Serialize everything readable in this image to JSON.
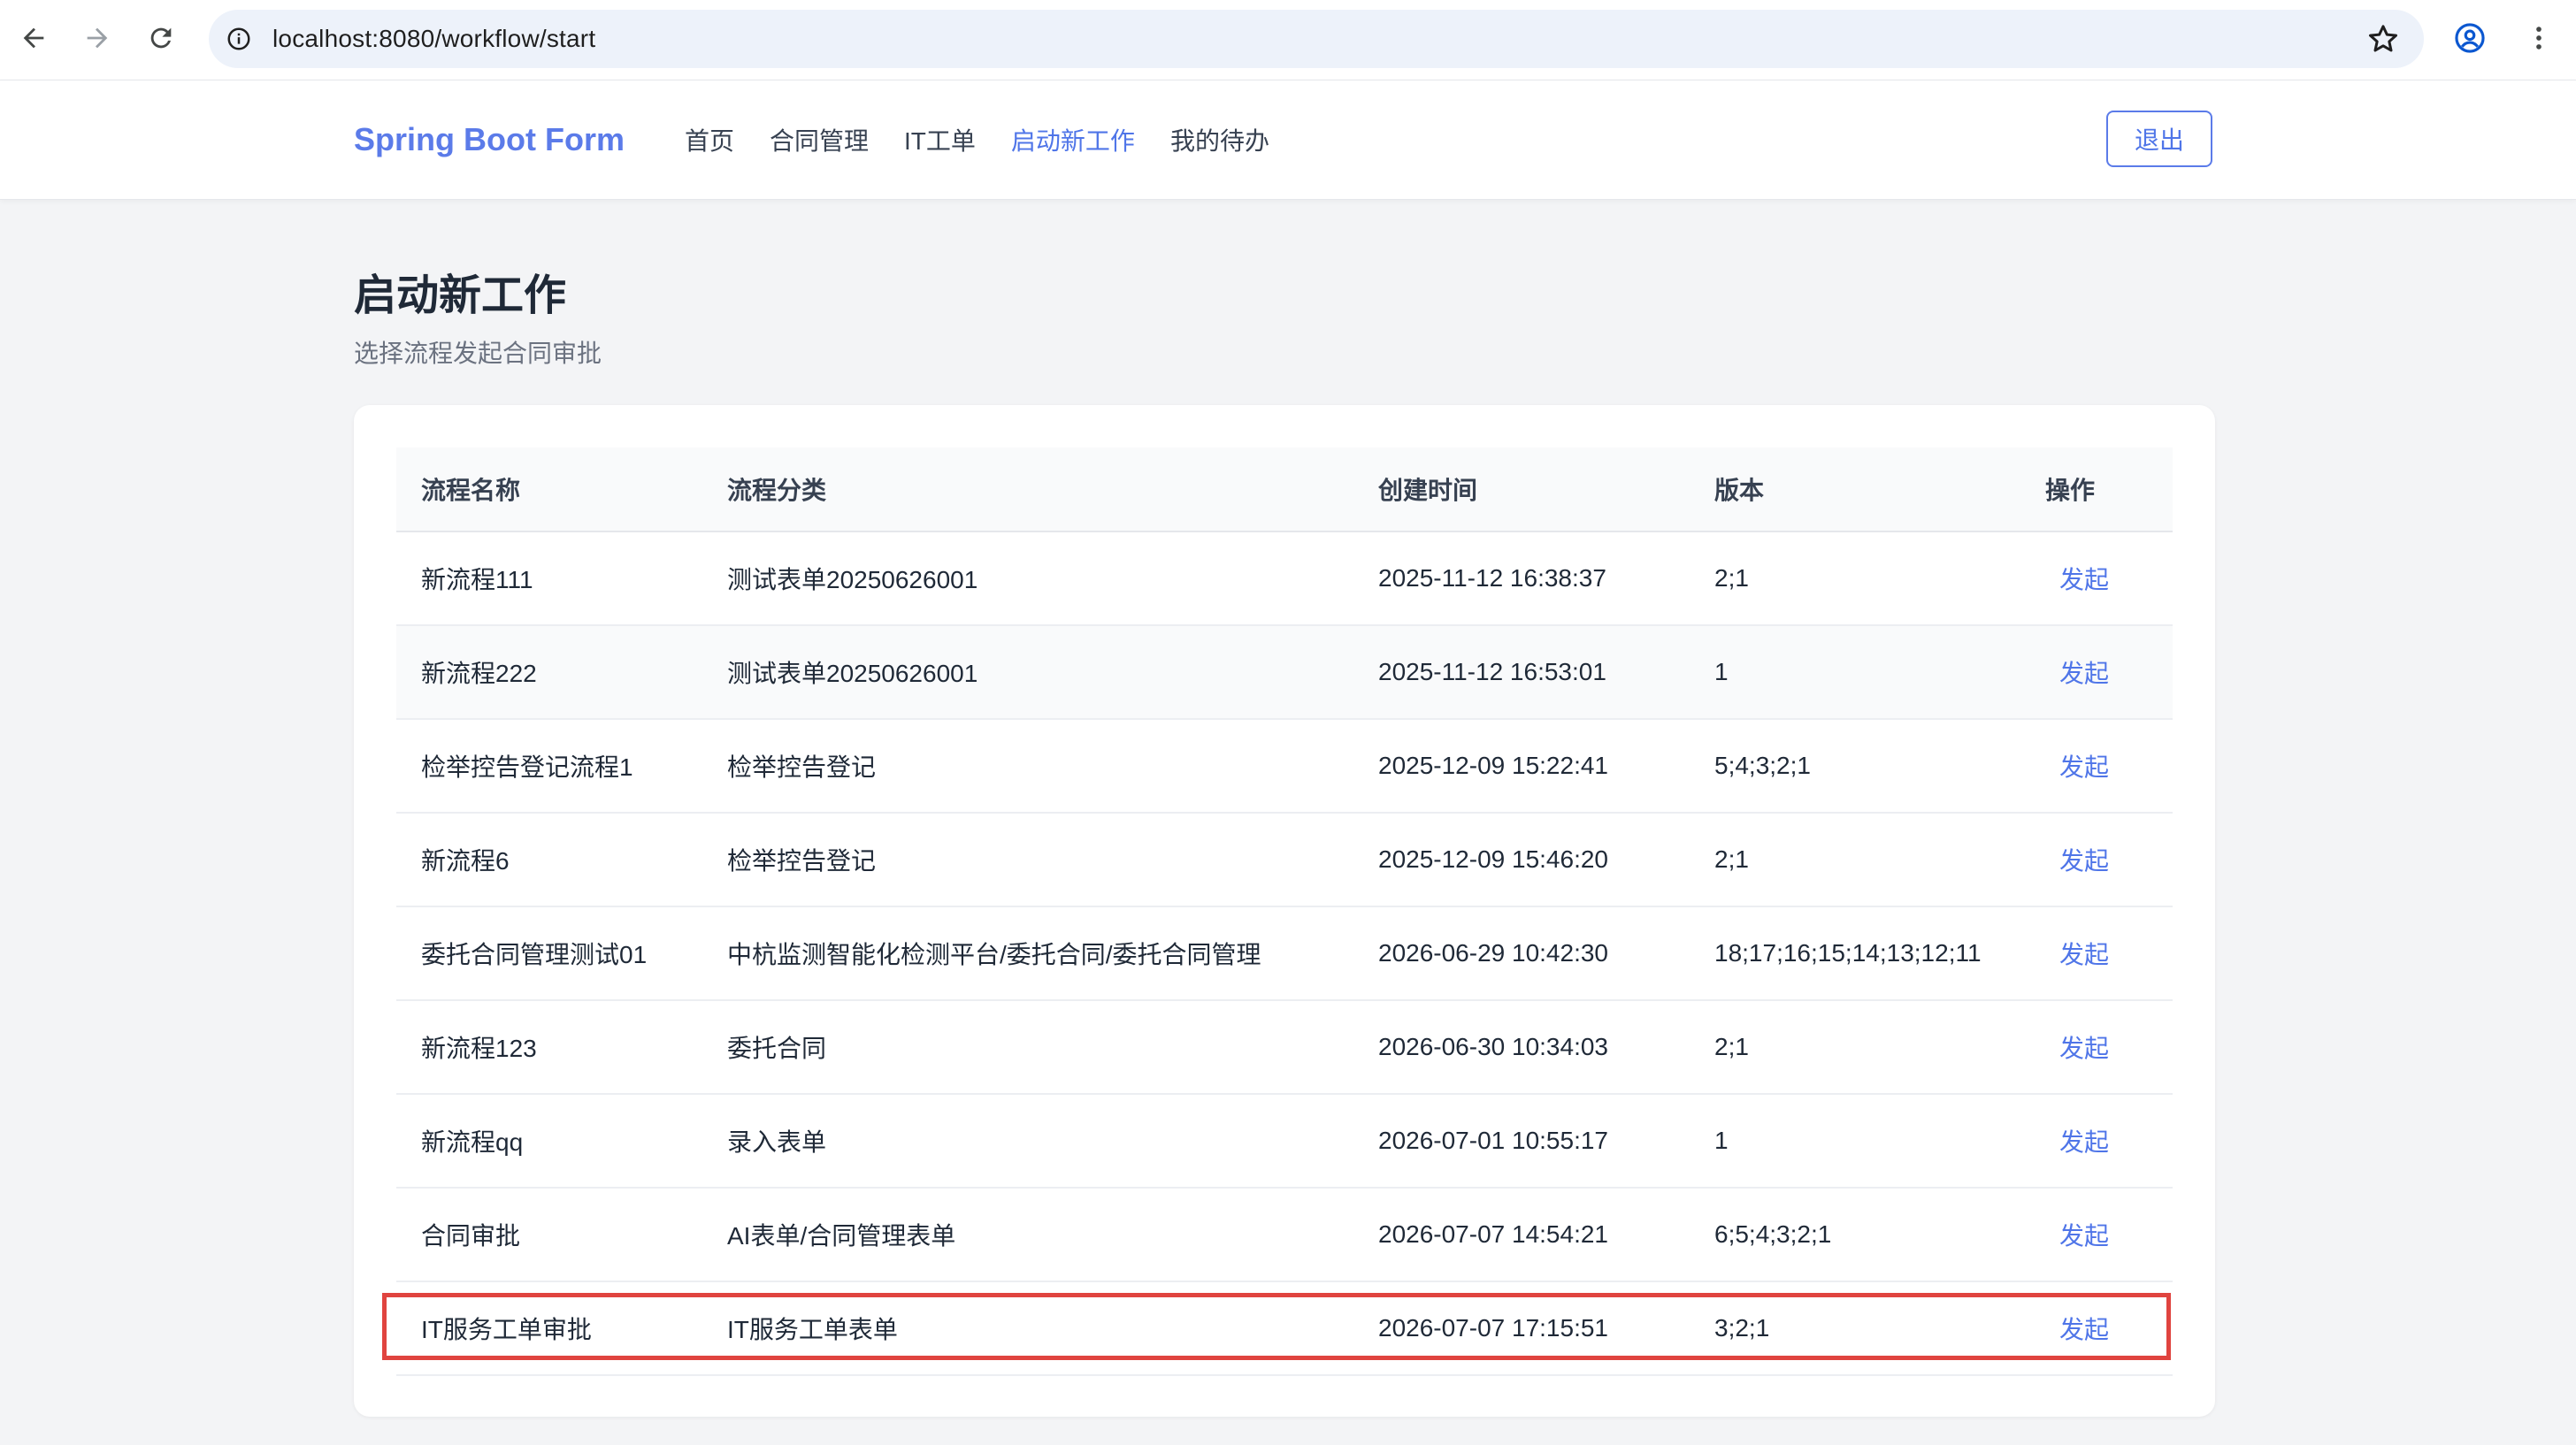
{
  "browser": {
    "url": "localhost:8080/workflow/start",
    "icons": {
      "back": "arrow-left-icon",
      "forward": "arrow-right-icon",
      "reload": "reload-icon",
      "site_info": "info-icon",
      "bookmark": "star-icon",
      "profile": "profile-icon",
      "menu": "kebab-menu-icon"
    }
  },
  "header": {
    "brand": "Spring Boot Form",
    "nav": [
      {
        "label": "首页"
      },
      {
        "label": "合同管理"
      },
      {
        "label": "IT工单"
      },
      {
        "label": "启动新工作",
        "active": true
      },
      {
        "label": "我的待办"
      }
    ],
    "logout_label": "退出"
  },
  "page": {
    "title": "启动新工作",
    "subtitle": "选择流程发起合同审批"
  },
  "table": {
    "columns": [
      "流程名称",
      "流程分类",
      "创建时间",
      "版本",
      "操作"
    ],
    "rows": [
      {
        "name": "新流程111",
        "category": "测试表单20250626001",
        "created": "2025-11-12 16:38:37",
        "version": "2;1",
        "action": "发起"
      },
      {
        "name": "新流程222",
        "category": "测试表单20250626001",
        "created": "2025-11-12 16:53:01",
        "version": "1",
        "action": "发起"
      },
      {
        "name": "检举控告登记流程1",
        "category": "检举控告登记",
        "created": "2025-12-09 15:22:41",
        "version": "5;4;3;2;1",
        "action": "发起"
      },
      {
        "name": "新流程6",
        "category": "检举控告登记",
        "created": "2025-12-09 15:46:20",
        "version": "2;1",
        "action": "发起"
      },
      {
        "name": "委托合同管理测试01",
        "category": "中杭监测智能化检测平台/委托合同/委托合同管理",
        "created": "2026-06-29 10:42:30",
        "version": "18;17;16;15;14;13;12;11",
        "action": "发起"
      },
      {
        "name": "新流程123",
        "category": "委托合同",
        "created": "2026-06-30 10:34:03",
        "version": "2;1",
        "action": "发起"
      },
      {
        "name": "新流程qq",
        "category": "录入表单",
        "created": "2026-07-01 10:55:17",
        "version": "1",
        "action": "发起"
      },
      {
        "name": "合同审批",
        "category": "AI表单/合同管理表单",
        "created": "2026-07-07 14:54:21",
        "version": "6;5;4;3;2;1",
        "action": "发起"
      },
      {
        "name": "IT服务工单审批",
        "category": "IT服务工单表单",
        "created": "2026-07-07 17:15:51",
        "version": "3;2;1",
        "action": "发起",
        "highlighted": true
      }
    ]
  },
  "colors": {
    "accent": "#4f75e8",
    "brand": "#5b7be9",
    "highlight_border": "#e0443f",
    "page_bg": "#f3f4f6"
  }
}
